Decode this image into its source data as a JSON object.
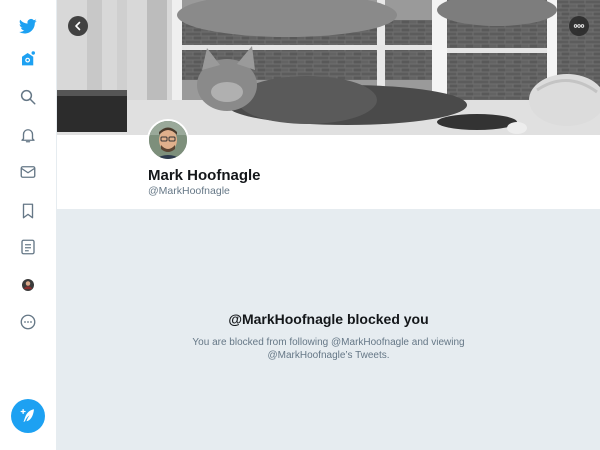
{
  "app": {
    "accent_color": "#1da1f2",
    "logo": "bird-icon"
  },
  "sidebar": {
    "items": [
      {
        "icon": "bird-logo-icon"
      },
      {
        "icon": "home-icon"
      },
      {
        "icon": "search-icon"
      },
      {
        "icon": "bell-icon"
      },
      {
        "icon": "mail-icon"
      },
      {
        "icon": "bookmark-icon"
      },
      {
        "icon": "list-icon"
      },
      {
        "icon": "profile-avatar"
      },
      {
        "icon": "more-icon"
      }
    ],
    "compose": {
      "icon": "compose-feather-icon"
    }
  },
  "banner": {
    "back_icon": "back-arrow-icon",
    "more_icon": "more-dots-icon"
  },
  "profile": {
    "name": "Mark Hoofnagle",
    "handle": "@MarkHoofnagle"
  },
  "blocked": {
    "title": "@MarkHoofnagle blocked you",
    "message": "You are blocked from following @MarkHoofnagle and viewing @MarkHoofnagle’s Tweets."
  }
}
